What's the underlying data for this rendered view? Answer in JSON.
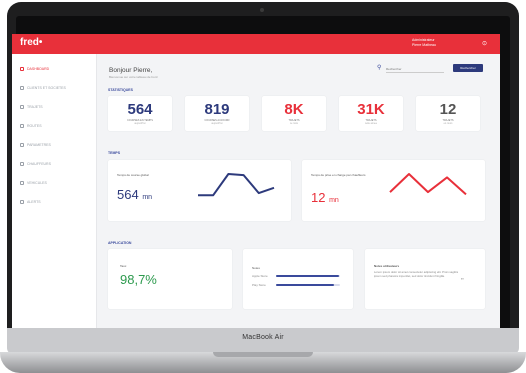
{
  "device": {
    "label": "MacBook Air"
  },
  "app": {
    "logo": "fred",
    "logo_mark": "•",
    "user_name": "Administrateur",
    "user_sub": "Pierre Matheau",
    "user_menu": "⊙"
  },
  "sidebar": {
    "items": [
      {
        "label": "DASHBOARD",
        "active": true
      },
      {
        "label": "CLIENTS ET SOCIETES",
        "active": false
      },
      {
        "label": "TRAJETS",
        "active": false
      },
      {
        "label": "ROUTES",
        "active": false
      },
      {
        "label": "PARAMETRES",
        "active": false
      },
      {
        "label": "CHAUFFEURS",
        "active": false
      },
      {
        "label": "VEHICULES",
        "active": false
      },
      {
        "label": "ALERTS",
        "active": false
      }
    ]
  },
  "header": {
    "greeting": "Bonjour Pierre,",
    "subtitle": "Bienvenue sur votre tableau de bord",
    "search_placeholder": "Rechercher",
    "search_button": "Rechercher"
  },
  "sections": {
    "statistics": "STATISTIQUES",
    "times": "TEMPS",
    "application": "APPLICATION"
  },
  "stats": [
    {
      "value": "564",
      "label": "COURSES EN TEMPS",
      "sub": "aujourd'hui",
      "color": "#2d3a7c"
    },
    {
      "value": "819",
      "label": "COURSES AUJOURD",
      "sub": "aujourd'hui",
      "color": "#2d3a7c"
    },
    {
      "value": "8K",
      "label": "TRAJETS",
      "sub": "ce mois",
      "color": "#e8303a"
    },
    {
      "value": "31K",
      "label": "TRAJETS",
      "sub": "cette annee",
      "color": "#e8303a"
    },
    {
      "value": "12",
      "label": "TRAJETS",
      "sub": "en cours",
      "color": "#555555"
    }
  ],
  "times": [
    {
      "label": "Temps de course global",
      "value": "564",
      "unit": "mn",
      "color": "#2d3a7c",
      "trend": [
        14,
        14,
        34,
        33,
        16,
        21
      ]
    },
    {
      "label": "Temps de prise en charge par chauffeurs",
      "value": "12",
      "unit": "mn",
      "color": "#e8303a",
      "trend": [
        14,
        30,
        14,
        27,
        12
      ]
    }
  ],
  "application": {
    "rate": {
      "label": "Taux",
      "value": "98,7%",
      "color": "#2d9a4e"
    },
    "stores": {
      "title": "Notes",
      "items": [
        {
          "label": "Apple Store",
          "fill": 0.98
        },
        {
          "label": "Play Store",
          "fill": 0.9
        }
      ]
    },
    "note": {
      "title": "Notes utilisateurs",
      "text": "Lorem ipsum dolor sit amet consectetur adipiscing elit. Proin sagittis ipsum sed pharetra imperdiet, sed dolor tincidunt fringilla.",
      "quote": "”"
    }
  }
}
